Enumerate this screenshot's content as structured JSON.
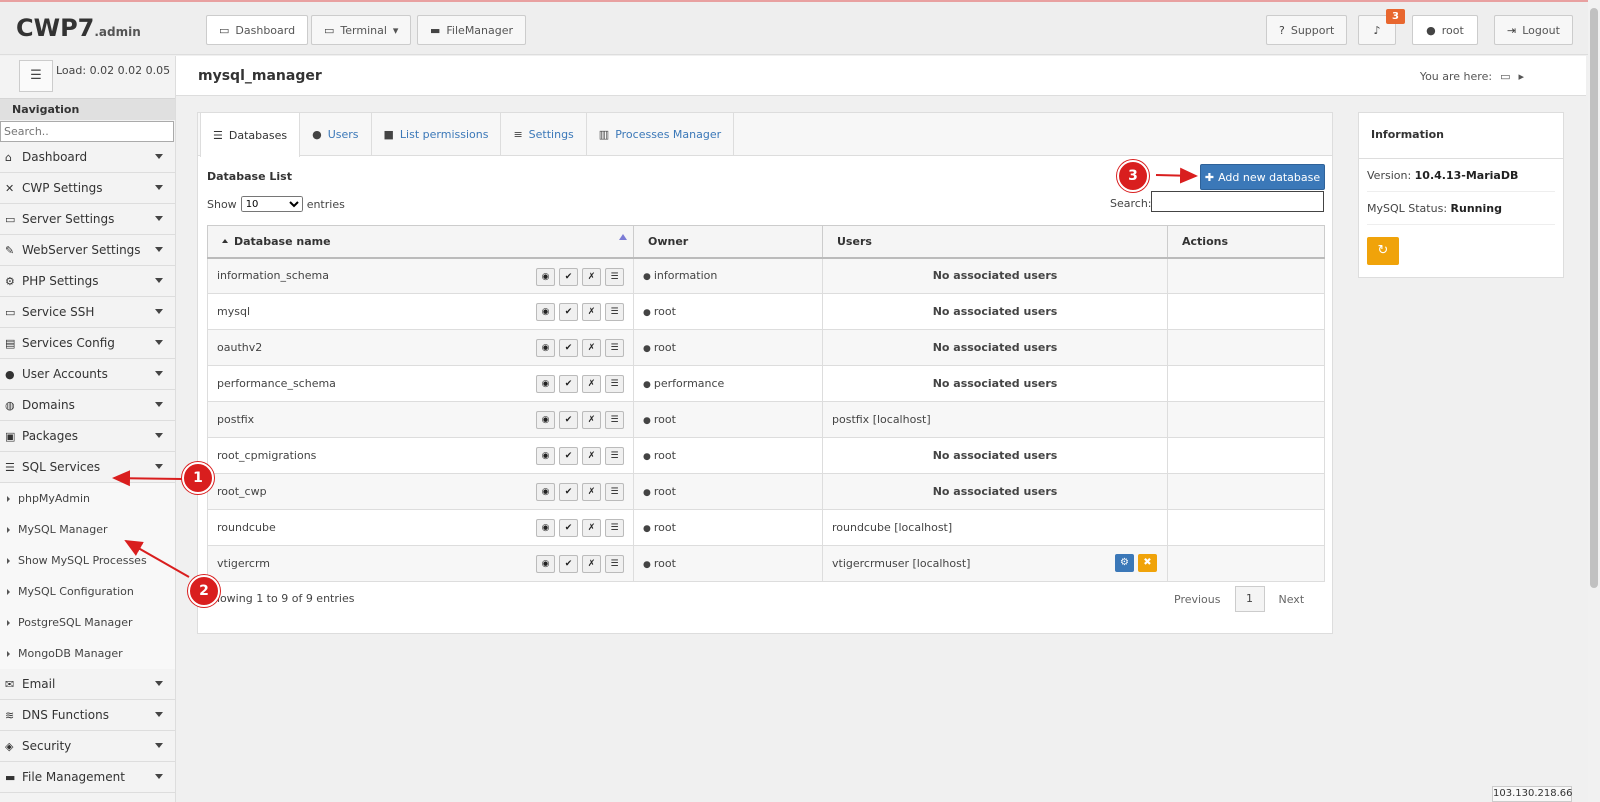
{
  "header": {
    "logo_main": "CWP7",
    "logo_sub": ".admin",
    "buttons": {
      "dashboard": "Dashboard",
      "terminal": "Terminal",
      "filemanager": "FileManager",
      "support": "Support",
      "user": "root",
      "logout": "Logout"
    },
    "notification_count": "3"
  },
  "subheader": {
    "title": "mysql_manager",
    "you_are_here": "You are here:"
  },
  "sidebar": {
    "load_label": "Load:",
    "load_values": "0.02  0.02  0.05",
    "nav_title": "Navigation",
    "search_placeholder": "Search..",
    "items": [
      {
        "label": "Dashboard",
        "icon": "home-icon"
      },
      {
        "label": "CWP Settings",
        "icon": "wrench-icon"
      },
      {
        "label": "Server Settings",
        "icon": "server-icon"
      },
      {
        "label": "WebServer Settings",
        "icon": "feather-icon"
      },
      {
        "label": "PHP Settings",
        "icon": "gear-icon"
      },
      {
        "label": "Service SSH",
        "icon": "monitor-icon"
      },
      {
        "label": "Services Config",
        "icon": "list-icon"
      },
      {
        "label": "User Accounts",
        "icon": "user-icon"
      },
      {
        "label": "Domains",
        "icon": "globe-icon"
      },
      {
        "label": "Packages",
        "icon": "cubes-icon"
      },
      {
        "label": "SQL Services",
        "icon": "database-icon"
      }
    ],
    "sql_sub_items": [
      "phpMyAdmin",
      "MySQL Manager",
      "Show MySQL Processes",
      "MySQL Configuration",
      "PostgreSQL Manager",
      "MongoDB Manager"
    ],
    "items_after": [
      {
        "label": "Email",
        "icon": "envelope-icon"
      },
      {
        "label": "DNS Functions",
        "icon": "layers-icon"
      },
      {
        "label": "Security",
        "icon": "shield-icon"
      },
      {
        "label": "File Management",
        "icon": "folder-icon"
      }
    ]
  },
  "tabs": [
    "Databases",
    "Users",
    "List permissions",
    "Settings",
    "Processes Manager"
  ],
  "main": {
    "list_title": "Database List",
    "show_label": "Show",
    "entries_label": "entries",
    "page_size": "10",
    "search_label": "Search:",
    "add_button": "Add new database",
    "columns": [
      "Database name",
      "Owner",
      "Users",
      "Actions"
    ],
    "rows": [
      {
        "name": "information_schema",
        "owner": "information",
        "users": "No associated users",
        "users_bold": true,
        "actions": false
      },
      {
        "name": "mysql",
        "owner": "root",
        "users": "No associated users",
        "users_bold": true,
        "actions": false
      },
      {
        "name": "oauthv2",
        "owner": "root",
        "users": "No associated users",
        "users_bold": true,
        "actions": false
      },
      {
        "name": "performance_schema",
        "owner": "performance",
        "users": "No associated users",
        "users_bold": true,
        "actions": false
      },
      {
        "name": "postfix",
        "owner": "root",
        "users": "postfix [localhost]",
        "users_bold": false,
        "actions": false
      },
      {
        "name": "root_cpmigrations",
        "owner": "root",
        "users": "No associated users",
        "users_bold": true,
        "actions": false
      },
      {
        "name": "root_cwp",
        "owner": "root",
        "users": "No associated users",
        "users_bold": true,
        "actions": false
      },
      {
        "name": "roundcube",
        "owner": "root",
        "users": "roundcube [localhost]",
        "users_bold": false,
        "actions": false
      },
      {
        "name": "vtigercrm",
        "owner": "root",
        "users": "vtigercrmuser [localhost]",
        "users_bold": false,
        "actions": true
      }
    ],
    "showing": "Showing 1 to 9 of 9 entries",
    "pager": {
      "prev": "Previous",
      "current": "1",
      "next": "Next"
    }
  },
  "info": {
    "title": "Information",
    "version_label": "Version:",
    "version_value": "10.4.13-MariaDB",
    "status_label": "MySQL Status:",
    "status_value": "Running"
  },
  "annotations": {
    "one": "1",
    "two": "2",
    "three": "3"
  },
  "ip": "103.130.218.66",
  "colors": {
    "primary": "#3b78b8",
    "warning": "#f0a30a",
    "annotation": "#d91e1e",
    "badge": "#e8672f"
  }
}
